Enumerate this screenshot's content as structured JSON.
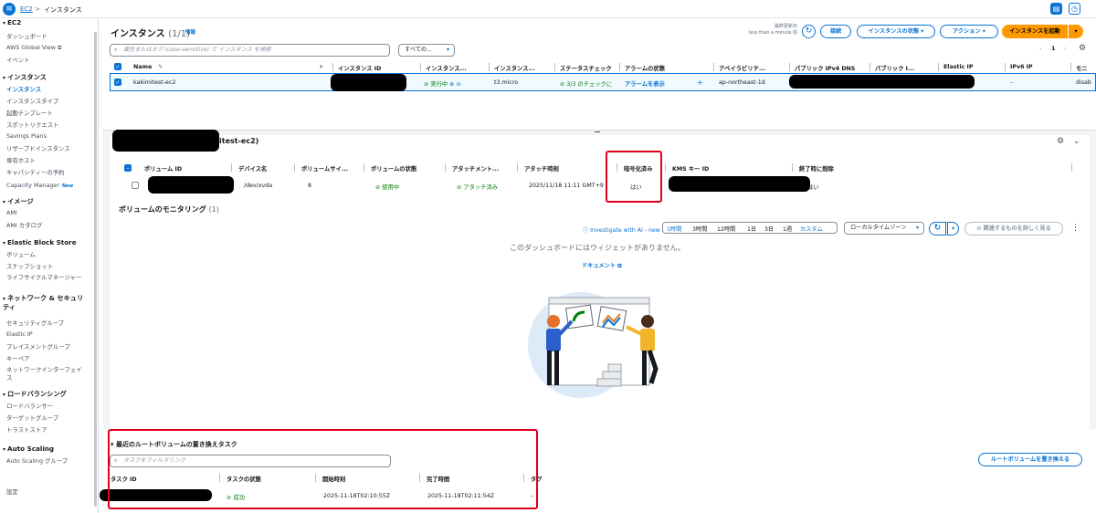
{
  "topbar": {
    "service": "EC2",
    "separator": ">",
    "page": "インスタンス",
    "menu_glyph": "≡"
  },
  "sidebar": {
    "items": [
      {
        "label": "EC2",
        "kind": "head"
      },
      {
        "label": "ダッシュボード",
        "kind": "item"
      },
      {
        "label": "AWS Global View",
        "kind": "item",
        "external": true
      },
      {
        "label": "イベント",
        "kind": "item"
      },
      {
        "label": "インスタンス",
        "kind": "head"
      },
      {
        "label": "インスタンス",
        "kind": "active"
      },
      {
        "label": "インスタンスタイプ",
        "kind": "item"
      },
      {
        "label": "起動テンプレート",
        "kind": "item"
      },
      {
        "label": "スポットリクエスト",
        "kind": "item"
      },
      {
        "label": "Savings Plans",
        "kind": "item"
      },
      {
        "label": "リザーブドインスタンス",
        "kind": "item"
      },
      {
        "label": "専有ホスト",
        "kind": "item"
      },
      {
        "label": "キャパシティーの予約",
        "kind": "item"
      },
      {
        "label": "Capacity Manager",
        "kind": "item",
        "badge": "New"
      },
      {
        "label": "イメージ",
        "kind": "head"
      },
      {
        "label": "AMI",
        "kind": "item"
      },
      {
        "label": "AMI カタログ",
        "kind": "item"
      },
      {
        "label": "Elastic Block Store",
        "kind": "head"
      },
      {
        "label": "ボリューム",
        "kind": "item"
      },
      {
        "label": "スナップショット",
        "kind": "item"
      },
      {
        "label": "ライフサイクルマネージャー",
        "kind": "item"
      },
      {
        "label": "ネットワーク & セキュリティ",
        "kind": "head"
      },
      {
        "label": "セキュリティグループ",
        "kind": "item"
      },
      {
        "label": "Elastic IP",
        "kind": "item"
      },
      {
        "label": "プレイスメントグループ",
        "kind": "item"
      },
      {
        "label": "キーペア",
        "kind": "item"
      },
      {
        "label": "ネットワークインターフェイス",
        "kind": "item"
      },
      {
        "label": "ロードバランシング",
        "kind": "head"
      },
      {
        "label": "ロードバランサー",
        "kind": "item"
      },
      {
        "label": "ターゲットグループ",
        "kind": "item"
      },
      {
        "label": "トラストストア",
        "kind": "item"
      },
      {
        "label": "Auto Scaling",
        "kind": "head"
      },
      {
        "label": "Auto Scaling グループ",
        "kind": "item"
      },
      {
        "label": "設定",
        "kind": "item"
      }
    ]
  },
  "instances": {
    "title": "インスタンス",
    "count": "(1/1)",
    "info": "情報",
    "last_updated_label": "最終更新日",
    "last_updated_value": "less than a minute 前",
    "buttons": {
      "connect": "接続",
      "state": "インスタンスの状態",
      "actions": "アクション",
      "launch": "インスタンスを起動"
    },
    "search_placeholder": "属性またはタグ (case-sensitive) で インスタンス を検索",
    "filter": "すべての...",
    "page": "1",
    "columns": [
      "Name",
      "インスタンス ID",
      "インスタンス...",
      "インスタンス...",
      "ステータスチェック",
      "アラームの状態",
      "アベイラビリテ...",
      "パブリック IPv4 DNS",
      "パブリック I...",
      "Elastic IP",
      "IPv6 IP",
      "モニ"
    ],
    "row": {
      "name": "kakimitest-ec2",
      "state": "実行中",
      "type": "t3.micro",
      "status": "3/3 のチェックに",
      "alarm": "アラームを表示",
      "alarm_add": "+",
      "az": "ap-northeast-1d",
      "elastic_ip": "–",
      "monitoring": "disab"
    }
  },
  "detail": {
    "title_suffix": "itest-ec2)",
    "columns": [
      "ボリューム ID",
      "デバイス名",
      "ボリュームサイ...",
      "ボリュームの状態",
      "アタッチメント...",
      "アタッチ時刻",
      "暗号化済み",
      "KMS キー ID",
      "終了時に削除"
    ],
    "row": {
      "device": "/dev/xvda",
      "size": "8",
      "state": "使用中",
      "attachment": "アタッチ済み",
      "attach_time": "2025/11/18 11:11 GMT+9",
      "encrypted": "はい",
      "delete_on_term": "はい"
    }
  },
  "monitoring": {
    "title": "ボリュームのモニタリング",
    "count": "(1)",
    "investigate": "Investigate with AI - new",
    "ranges": [
      "1時間",
      "3時間",
      "12時間",
      "1日",
      "3日",
      "1週",
      "カスタム"
    ],
    "timezone": "ローカルタイムゾーン",
    "explore": "関連するものを詳しく見る",
    "empty": "このダッシュボードにはウィジェットがありません。",
    "doc_link": "ドキュメント"
  },
  "root_tasks": {
    "title": "最近のルートボリュームの置き換えタスク",
    "filter_placeholder": "タスクをフィルタリング",
    "replace_button": "ルートボリュームを置き換える",
    "columns": [
      "タスク ID",
      "タスクの状態",
      "開始時刻",
      "完了時間",
      "タグ"
    ],
    "row": {
      "state": "成功",
      "start": "2025-11-18T02:10:55Z",
      "end": "2025-11-18T02:11:54Z",
      "tags": "–"
    }
  },
  "colors": {
    "primary": "#0972d3",
    "orange": "#ff9900",
    "success": "#037f0c",
    "highlight": "#e0001b"
  },
  "icons": [
    "menu-icon",
    "search-icon",
    "refresh-icon",
    "settings-icon",
    "external-link-icon",
    "check-circle-icon",
    "zoom-icon"
  ]
}
